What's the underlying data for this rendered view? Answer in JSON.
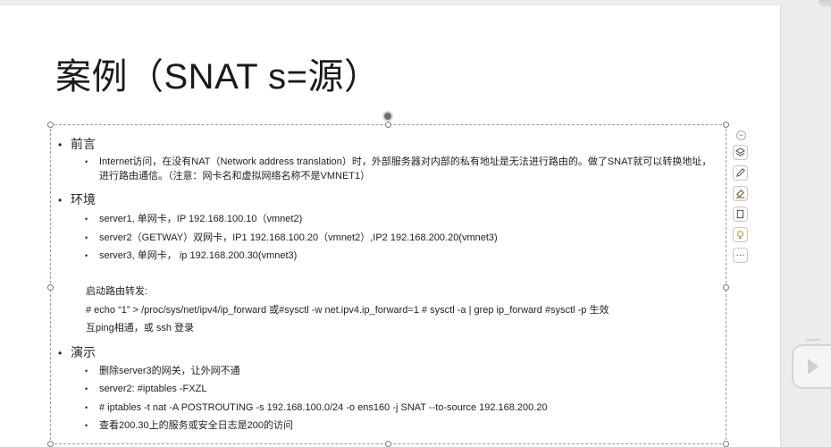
{
  "slide": {
    "title": "案例（SNAT s=源）"
  },
  "content": {
    "sections": [
      {
        "heading": "前言",
        "items": [
          "Internet访问，在没有NAT（Network address translation）时，外部服务器对内部的私有地址是无法进行路由的。做了SNAT就可以转换地址，进行路由通信。（注意：网卡名和虚拟网络名称不是VMNET1）"
        ]
      },
      {
        "heading": "环境",
        "items": [
          "server1, 单网卡，IP 192.168.100.10（vmnet2)",
          "server2（GETWAY）双网卡，IP1 192.168.100.20（vmnet2）,IP2 192.168.200.20(vmnet3)",
          "server3, 单网卡，  ip 192.168.200.30(vmnet3)"
        ],
        "notes": [
          "启动路由转发:",
          "# echo “1” > /proc/sys/net/ipv4/ip_forward  或#sysctl -w net.ipv4.ip_forward=1   # sysctl -a | grep ip_forward   #sysctl -p  生效",
          "互ping相通，或 ssh 登录"
        ]
      },
      {
        "heading": "演示",
        "items": [
          "删除server3的网关，让外网不通",
          "server2:  #iptables -FXZL",
          "# iptables -t nat -A POSTROUTING -s 192.168.100.0/24 -o ens160 -j SNAT --to-source 192.168.200.20",
          "查看200.30上的服务或安全日志是200的访问"
        ]
      }
    ]
  },
  "toolbar": {
    "collapse_glyph": "−",
    "more_glyph": "···",
    "buttons": [
      {
        "icon": "layers-icon"
      },
      {
        "icon": "pen-icon"
      },
      {
        "icon": "eraser-icon"
      },
      {
        "icon": "crop-icon"
      },
      {
        "icon": "lightbulb-icon"
      },
      {
        "icon": "more-icon"
      }
    ]
  },
  "colors": {
    "slide_bg": "#ffffff",
    "workspace_bg": "#ececec",
    "text": "#222222"
  }
}
